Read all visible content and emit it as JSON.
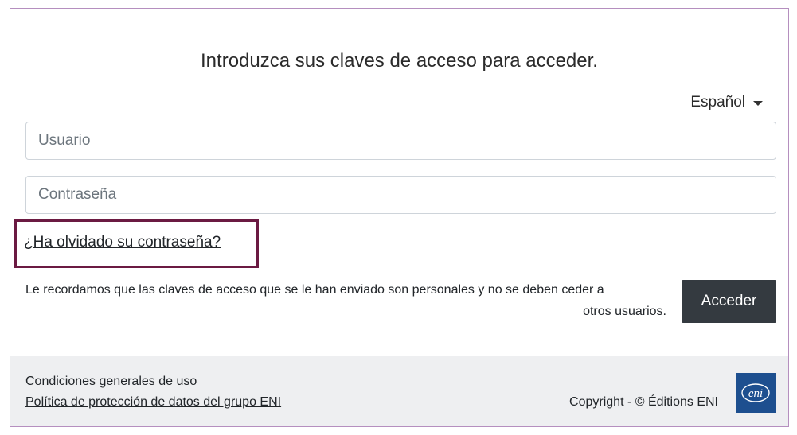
{
  "header": {
    "title": "Introduzca sus claves de acceso para acceder."
  },
  "language": {
    "selected": "Español"
  },
  "form": {
    "username_placeholder": "Usuario",
    "username_value": "",
    "password_placeholder": "Contraseña",
    "password_value": "",
    "forgot_link": "¿Ha olvidado su contraseña?",
    "notice_line1": "Le recordamos que las claves de acceso que se le han enviado son personales y no se deben ceder a",
    "notice_line2": "otros usuarios.",
    "submit_label": "Acceder"
  },
  "footer": {
    "terms_link": "Condiciones generales de uso",
    "privacy_link": "Política de protección de datos del grupo ENI",
    "copyright": "Copyright - © Éditions ENI",
    "logo_text": "eni"
  },
  "colors": {
    "button_bg": "#343a40",
    "highlight_border": "#6b1a42",
    "logo_bg": "#1d4f8f",
    "footer_bg": "#eeeff1"
  },
  "icons": {
    "language_caret": "caret-down-icon",
    "logo": "eni-logo"
  }
}
